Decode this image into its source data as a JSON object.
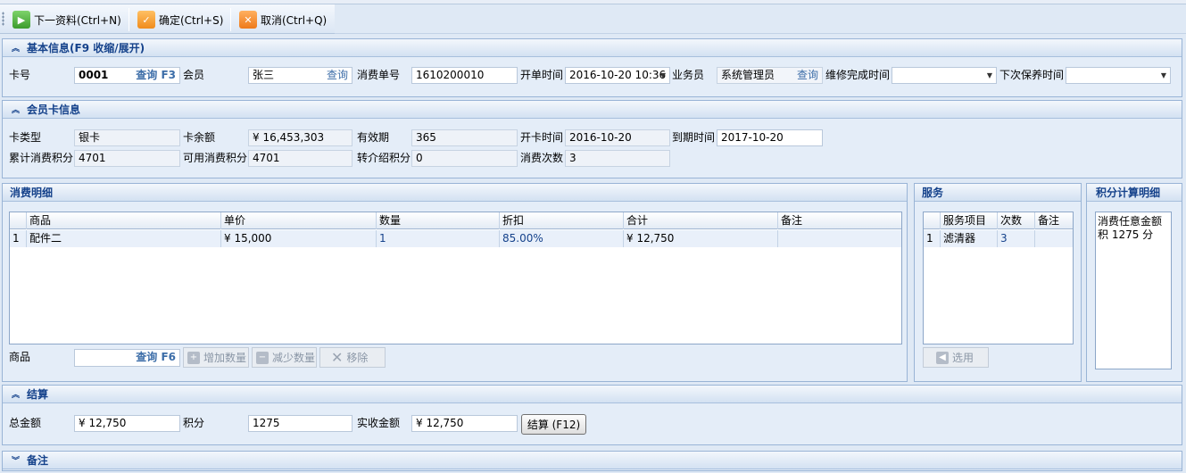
{
  "toolbar": {
    "next_label": "下一资料(Ctrl+N)",
    "confirm_label": "确定(Ctrl+S)",
    "cancel_label": "取消(Ctrl+Q)"
  },
  "basic": {
    "title": "基本信息(F9 收缩/展开)",
    "card_no_label": "卡号",
    "card_no_value": "0001",
    "card_query": "查询 F3",
    "member_label": "会员",
    "member_value": "张三",
    "member_query": "查询",
    "order_no_label": "消费单号",
    "order_no_value": "1610200010",
    "open_time_label": "开单时间",
    "open_time_value": "2016-10-20 10:36",
    "sales_label": "业务员",
    "sales_value": "系统管理员",
    "sales_query": "查询",
    "repair_done_label": "维修完成时间",
    "repair_done_value": "",
    "next_maint_label": "下次保养时间",
    "next_maint_value": ""
  },
  "card": {
    "title": "会员卡信息",
    "type_label": "卡类型",
    "type_value": "银卡",
    "balance_label": "卡余额",
    "balance_value": "¥ 16,453,303",
    "validity_label": "有效期",
    "validity_value": "365",
    "open_date_label": "开卡时间",
    "open_date_value": "2016-10-20",
    "expire_label": "到期时间",
    "expire_value": "2017-10-20",
    "total_points_label": "累计消费积分",
    "total_points_value": "4701",
    "avail_points_label": "可用消费积分",
    "avail_points_value": "4701",
    "ref_points_label": "转介绍积分",
    "ref_points_value": "0",
    "visits_label": "消费次数",
    "visits_value": "3"
  },
  "detail": {
    "title": "消费明细",
    "columns": [
      "商品",
      "单价",
      "数量",
      "折扣",
      "合计",
      "备注"
    ],
    "rows": [
      {
        "idx": "1",
        "product": "配件二",
        "price": "¥ 15,000",
        "qty": "1",
        "discount": "85.00%",
        "total": "¥ 12,750",
        "note": ""
      }
    ],
    "product_label": "商品",
    "product_query": "查询 F6",
    "add_qty": "增加数量",
    "reduce_qty": "减少数量",
    "remove": "移除"
  },
  "service": {
    "title": "服务",
    "columns": [
      "服务项目",
      "次数",
      "备注"
    ],
    "rows": [
      {
        "idx": "1",
        "item": "滤清器",
        "count": "3",
        "note": ""
      }
    ],
    "select_label": "选用"
  },
  "points": {
    "title": "积分计算明细",
    "text": "消费任意金额积 1275 分"
  },
  "settle": {
    "title": "结算",
    "total_label": "总金额",
    "total_value": "¥ 12,750",
    "points_label": "积分",
    "points_value": "1275",
    "received_label": "实收金额",
    "received_value": "¥ 12,750",
    "settle_button": "结算 (F12)"
  },
  "remark": {
    "title": "备注"
  },
  "colors": {
    "panel_title": "#15428b",
    "panel_bg": "#e4edf8",
    "link": "#3c6da8"
  },
  "icons": [
    "play-icon",
    "check-icon",
    "close-icon",
    "plus-icon",
    "minus-icon",
    "x-icon",
    "select-icon",
    "chevron-up-icon",
    "chevron-down-icon"
  ]
}
